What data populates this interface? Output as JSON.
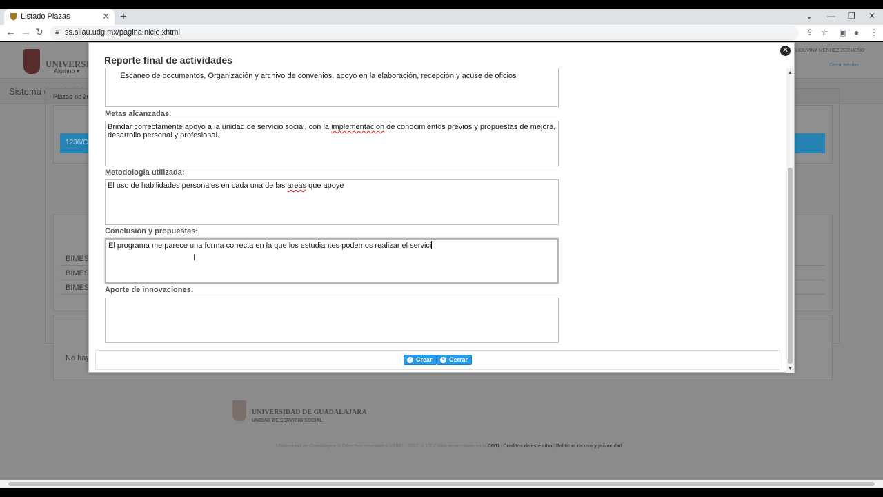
{
  "browser": {
    "tab_title": "Listado Plazas",
    "url": "ss.siiau.udg.mx/paginaInicio.xhtml"
  },
  "background": {
    "university_name": "UNIVERSIDAD D",
    "user_name": "LIDUVINA MENDEZ ZERMEÑO",
    "logout": "Cerrar sesión",
    "system_title": "Sistema de Administra",
    "menu_alumno": "Alumno ▾",
    "panel_title": "Plazas de 20",
    "selected_row": "1236/C",
    "rows": [
      "BIMES",
      "BIMES",
      "BIMES"
    ],
    "no_records": "No hay",
    "footer_university": "UNIVERSIDAD DE GUADALAJARA",
    "footer_unit": "UNIDAD DE SERVICIO SOCIAL",
    "footer_copy": "Universidad de Guadalajara © Derechos reservados ©1997 - 2022. v 1.0.2 Sitio desarrollado en la",
    "footer_cgti": "CGTI",
    "footer_credits": "Créditos de este sitio",
    "footer_policies": "Políticas de uso y privacidad"
  },
  "modal": {
    "title": "Reporte final de actividades",
    "first_field_value": "Escaneo de documentos, Organización y archivo de convenios. apoyo en la elaboración, recepción y acuse de oficios",
    "fields": {
      "metas": {
        "label": "Metas alcanzadas:",
        "value_1": "Brindar correctamente apoyo a la unidad de servicio social, con la ",
        "value_misspelled": "implementacion",
        "value_2": " de conocimientos previos y propuestas de mejora, desarrollo personal y profesional."
      },
      "metodologia": {
        "label": "Metodologia utilizada:",
        "value_1": "El uso de habilidades personales en cada una de las ",
        "value_misspelled": "areas",
        "value_2": " que apoye"
      },
      "conclusion": {
        "label": "Conclusión y propuestas:",
        "value": "El programa me parece una forma correcta en la que los estudiantes podemos realizar el servici"
      },
      "aporte": {
        "label": "Aporte de innovaciones:",
        "value": ""
      }
    },
    "buttons": {
      "crear": "Crear",
      "cerrar": "Cerrar"
    }
  }
}
